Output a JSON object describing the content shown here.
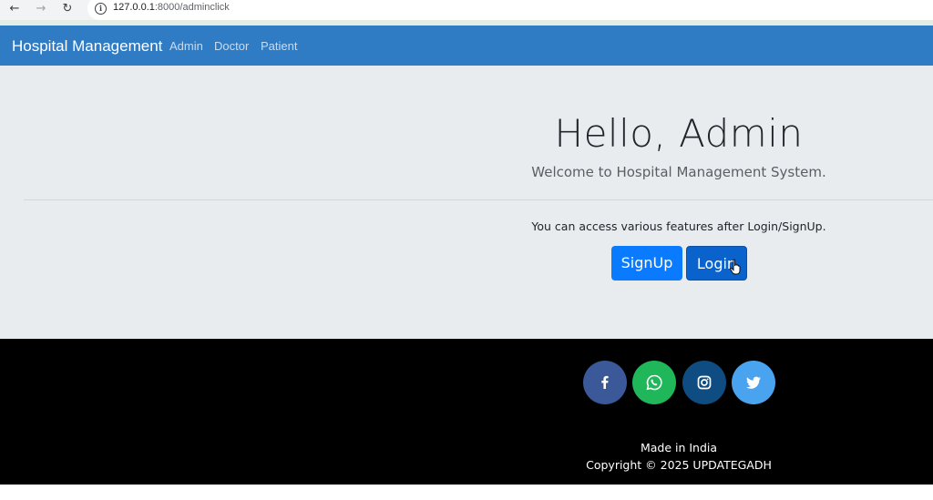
{
  "browser": {
    "url_host": "127.0.0.1",
    "url_rest": ":8000/adminclick"
  },
  "navbar": {
    "brand": "Hospital Management",
    "links": [
      "Admin",
      "Doctor",
      "Patient"
    ]
  },
  "hero": {
    "title": "Hello, Admin",
    "subtitle": "Welcome to Hospital Management System.",
    "note": "You can access various features after Login/SignUp.",
    "signup_label": "SignUp",
    "login_label": "Login"
  },
  "footer": {
    "socials": [
      {
        "icon": "facebook-icon",
        "color": "#3b5998"
      },
      {
        "icon": "whatsapp-icon",
        "color": "#1fb75a"
      },
      {
        "icon": "instagram-icon",
        "color": "#0f4c81"
      },
      {
        "icon": "twitter-icon",
        "color": "#4aa3ef"
      }
    ],
    "made_in": "Made in India",
    "copyright": "Copyright © 2025 UPDATEGADH"
  }
}
